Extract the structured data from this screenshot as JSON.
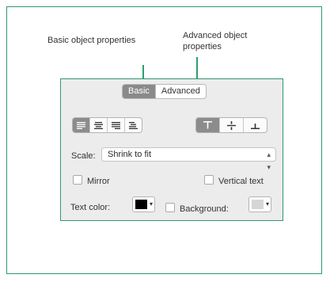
{
  "callouts": {
    "basic": "Basic object properties",
    "advanced_line1": "Advanced object",
    "advanced_line2": "properties"
  },
  "tabs": [
    {
      "label": "Basic",
      "active": true
    },
    {
      "label": "Advanced",
      "active": false
    }
  ],
  "alignment": {
    "horizontal": [
      "align-left-icon",
      "align-center-icon",
      "align-right-icon",
      "align-justify-icon"
    ],
    "horizontal_selected": "align-left-icon",
    "vertical": [
      "align-top-icon",
      "align-middle-icon",
      "align-bottom-icon"
    ],
    "vertical_selected": "align-top-icon"
  },
  "scale": {
    "label": "Scale:",
    "value": "Shrink to fit"
  },
  "mirror": {
    "label": "Mirror",
    "checked": false
  },
  "vertical_text": {
    "label": "Vertical text",
    "checked": false
  },
  "text_color": {
    "label": "Text color:",
    "color": "#000000"
  },
  "background": {
    "label": "Background:",
    "checked": false,
    "color": "#d6d6d6"
  },
  "colors": {
    "accent": "#2e9a6b",
    "panel": "#ececec"
  }
}
